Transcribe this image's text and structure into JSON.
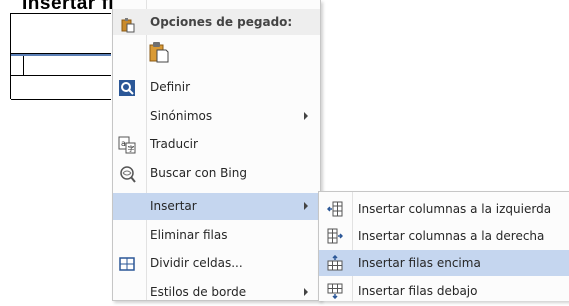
{
  "document": {
    "heading": "Insertar filas"
  },
  "context_menu": {
    "paste_header": "Opciones de pegado:",
    "items": [
      {
        "label": "Definir",
        "icon": "define-icon",
        "has_submenu": false
      },
      {
        "label": "Sinónimos",
        "icon": "",
        "has_submenu": true
      },
      {
        "label": "Traducir",
        "icon": "translate-icon",
        "has_submenu": false
      },
      {
        "label": "Buscar con Bing",
        "icon": "bing-search-icon",
        "has_submenu": false
      },
      {
        "label": "Insertar",
        "icon": "",
        "has_submenu": true,
        "active": true
      },
      {
        "label": "Eliminar filas",
        "icon": "",
        "has_submenu": false
      },
      {
        "label": "Dividir celdas...",
        "icon": "split-cells-icon",
        "has_submenu": false
      },
      {
        "label": "Estilos de borde",
        "icon": "",
        "has_submenu": true
      }
    ]
  },
  "submenu": {
    "items": [
      {
        "label": "Insertar columnas a la izquierda",
        "icon": "insert-columns-left-icon"
      },
      {
        "label": "Insertar columnas a la derecha",
        "icon": "insert-columns-right-icon"
      },
      {
        "label": "Insertar filas encima",
        "icon": "insert-rows-above-icon",
        "active": true
      },
      {
        "label": "Insertar filas debajo",
        "icon": "insert-rows-below-icon"
      }
    ]
  },
  "colors": {
    "highlight": "#c5d6ef",
    "accent_blue": "#2b5797"
  }
}
